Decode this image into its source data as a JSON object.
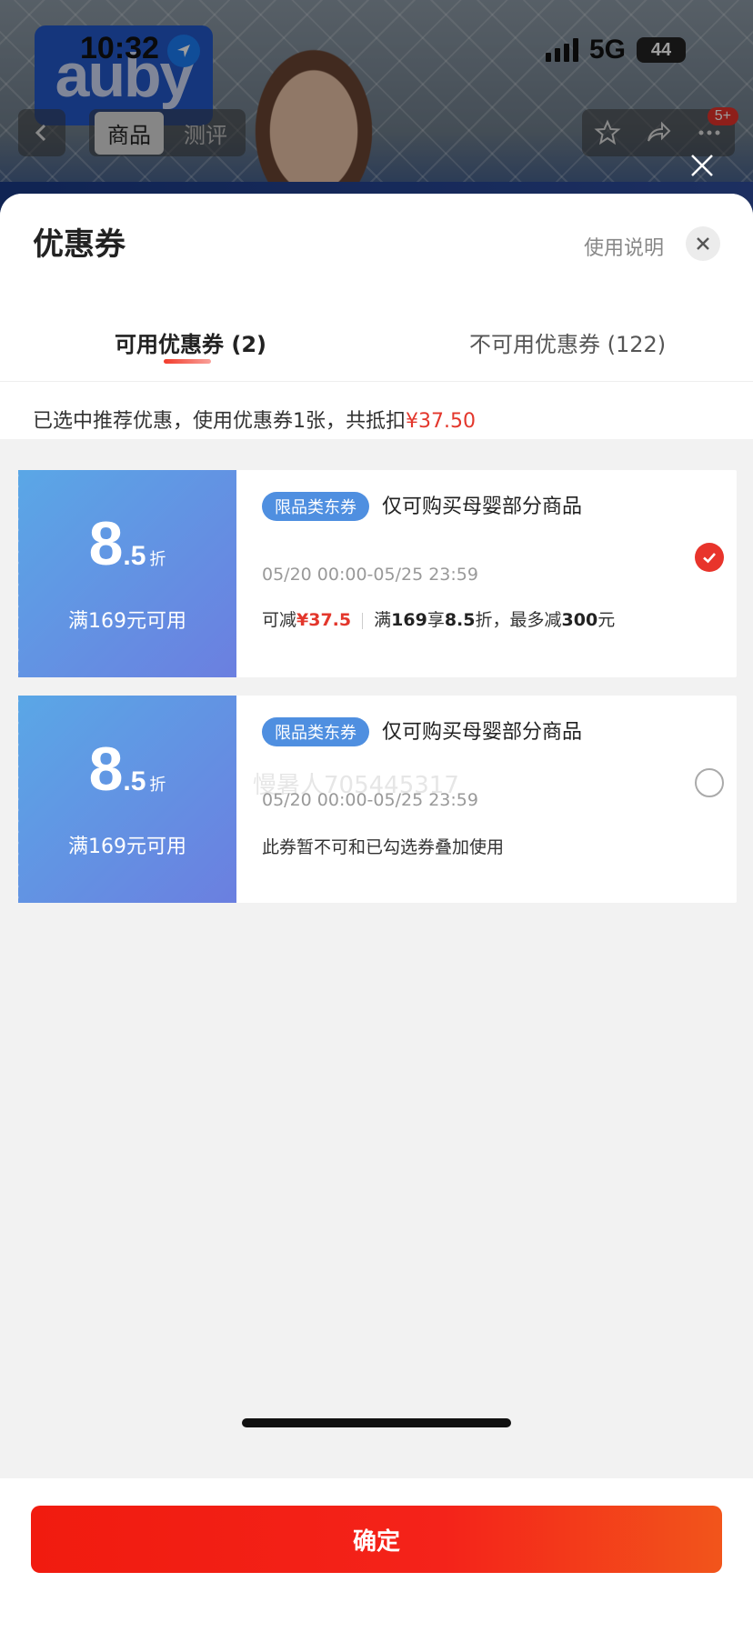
{
  "status_bar": {
    "time": "10:32",
    "network": "5G",
    "battery": "44"
  },
  "background_page": {
    "logo_text": "auby",
    "nav_tabs": [
      "商品",
      "测评"
    ],
    "cart_badge": "5+"
  },
  "sheet": {
    "title": "优惠券",
    "help_link": "使用说明",
    "tabs": [
      {
        "label": "可用优惠券 (2)",
        "active": true
      },
      {
        "label": "不可用优惠券 (122)",
        "active": false
      }
    ],
    "summary_prefix": "已选中推荐优惠，使用优惠券1张，共抵扣",
    "summary_amount": "¥37.50",
    "coupons": [
      {
        "discount_int": "8",
        "discount_dec": ".5",
        "discount_unit": "折",
        "threshold": "满169元可用",
        "tag": "限品类东券",
        "scope": "仅可购买母婴部分商品",
        "validity": "05/20 00:00-05/25 23:59",
        "save_label": "可减",
        "save_amount": "¥37.5",
        "rule_prefix": "满",
        "rule_threshold": "169",
        "rule_mid": "享",
        "rule_discount": "8.5",
        "rule_mid2": "折，最多减",
        "rule_max": "300",
        "rule_suffix": "元",
        "selected": true
      },
      {
        "discount_int": "8",
        "discount_dec": ".5",
        "discount_unit": "折",
        "threshold": "满169元可用",
        "tag": "限品类东券",
        "scope": "仅可购买母婴部分商品",
        "validity": "05/20 00:00-05/25 23:59",
        "watermark": "慢暑人705445317",
        "note": "此券暂不可和已勾选券叠加使用",
        "selected": false
      }
    ],
    "confirm_label": "确定"
  },
  "colors": {
    "accent_red": "#e3372c",
    "coupon_blue": "#5aa7e6",
    "tag_blue": "#4f8fe0"
  }
}
